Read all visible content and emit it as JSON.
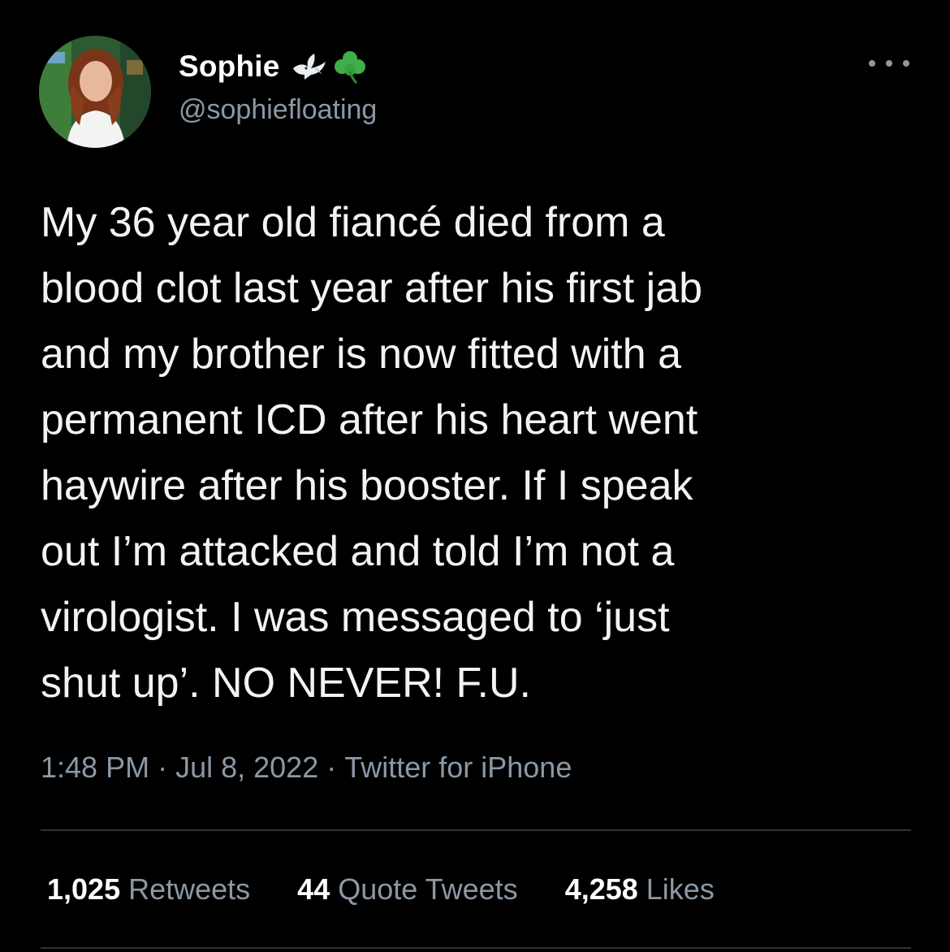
{
  "user": {
    "display_name": "Sophie",
    "handle": "@sophiefloating",
    "badges": [
      "dove-icon",
      "shamrock-icon"
    ]
  },
  "tweet": {
    "lines": [
      "My 36 year old fiancé died from a",
      "blood clot last year after his first jab",
      "and my brother is now fitted with a",
      "permanent ICD after his heart went",
      "haywire after his booster. If I speak",
      "out I’m attacked and told I’m not a",
      "virologist. I was messaged to ‘just",
      "shut up’. NO NEVER! F.U."
    ],
    "time": "1:48 PM",
    "date": "Jul 8, 2022",
    "source": "Twitter for iPhone",
    "separator": "·"
  },
  "stats": {
    "retweets": {
      "count": "1,025",
      "label": "Retweets"
    },
    "quotes": {
      "count": "44",
      "label": "Quote Tweets"
    },
    "likes": {
      "count": "4,258",
      "label": "Likes"
    }
  },
  "colors": {
    "background": "#000000",
    "text": "#e7e9ea",
    "secondary": "#8b98a5",
    "divider": "#2f3336"
  }
}
